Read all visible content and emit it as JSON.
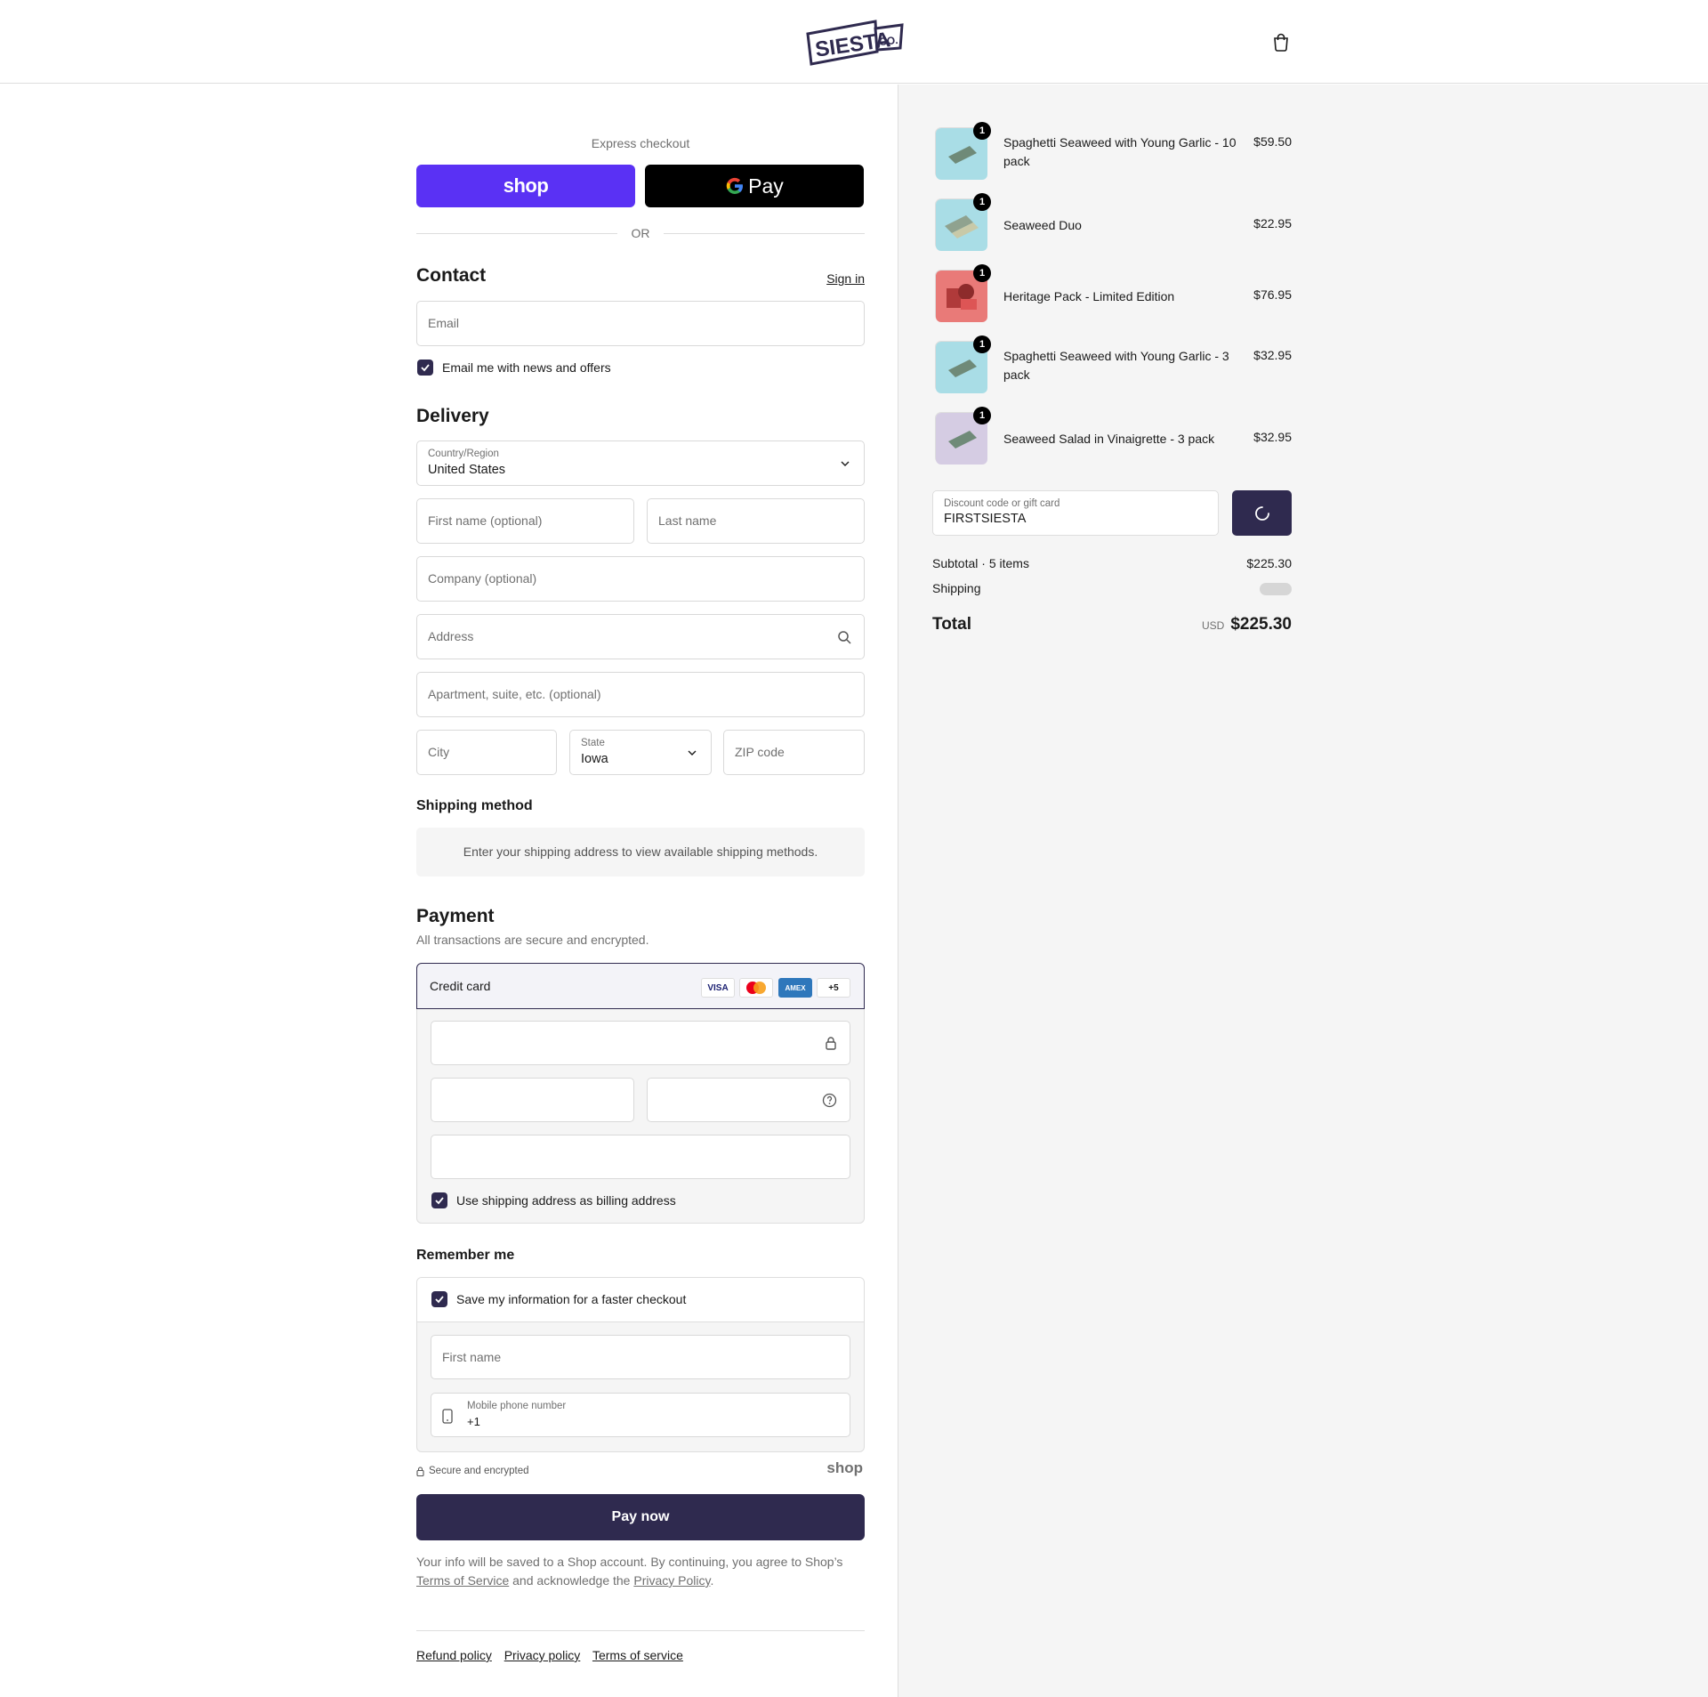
{
  "header": {
    "logo_main": "SIESTA",
    "logo_sub": "CO."
  },
  "express": {
    "label": "Express checkout",
    "shop_label": "shop",
    "gpay_label": "Pay",
    "or_label": "OR"
  },
  "contact": {
    "title": "Contact",
    "sign_in": "Sign in",
    "email_placeholder": "Email",
    "news_label": "Email me with news and offers"
  },
  "delivery": {
    "title": "Delivery",
    "country_label": "Country/Region",
    "country_value": "United States",
    "first_name_placeholder": "First name (optional)",
    "last_name_placeholder": "Last name",
    "company_placeholder": "Company (optional)",
    "address_placeholder": "Address",
    "apartment_placeholder": "Apartment, suite, etc. (optional)",
    "city_placeholder": "City",
    "state_label": "State",
    "state_value": "Iowa",
    "zip_placeholder": "ZIP code"
  },
  "shipping_method": {
    "title": "Shipping method",
    "notice": "Enter your shipping address to view available shipping methods."
  },
  "payment": {
    "title": "Payment",
    "subtitle": "All transactions are secure and encrypted.",
    "method": "Credit card",
    "brands": [
      "VISA",
      "",
      "AMEX",
      "+5"
    ],
    "billing_label": "Use shipping address as billing address"
  },
  "remember": {
    "title": "Remember me",
    "save_label": "Save my information for a faster checkout",
    "first_name_placeholder": "First name",
    "phone_label": "Mobile phone number",
    "phone_value": "+1",
    "secure_label": "Secure and encrypted",
    "shop_mark": "shop"
  },
  "pay_now": "Pay now",
  "legal": {
    "text1": "Your info will be saved to a Shop account. By continuing, you agree to Shop’s ",
    "terms": "Terms of Service",
    "text2": " and acknowledge the ",
    "privacy": "Privacy Policy",
    "text3": "."
  },
  "footer": {
    "links": [
      "Refund policy",
      "Privacy policy",
      "Terms of service"
    ]
  },
  "cart": {
    "items": [
      {
        "name": "Spaghetti Seaweed with Young Garlic - 10 pack",
        "price": "$59.50",
        "qty": "1",
        "bg": "#a9dde6"
      },
      {
        "name": "Seaweed Duo",
        "price": "$22.95",
        "qty": "1",
        "bg": "#a9dde6"
      },
      {
        "name": "Heritage Pack - Limited Edition",
        "price": "$76.95",
        "qty": "1",
        "bg": "#e97a78"
      },
      {
        "name": "Spaghetti Seaweed with Young Garlic - 3 pack",
        "price": "$32.95",
        "qty": "1",
        "bg": "#a9dde6"
      },
      {
        "name": "Seaweed Salad in Vinaigrette - 3 pack",
        "price": "$32.95",
        "qty": "1",
        "bg": "#d5cce3"
      }
    ],
    "discount_label": "Discount code or gift card",
    "discount_value": "FIRSTSIESTA",
    "subtotal_label": "Subtotal · 5 items",
    "subtotal_value": "$225.30",
    "shipping_label": "Shipping",
    "total_label": "Total",
    "currency": "USD",
    "total_value": "$225.30"
  },
  "colors": {
    "accent": "#2f2a4f",
    "shop_purple": "#5a31f4"
  }
}
